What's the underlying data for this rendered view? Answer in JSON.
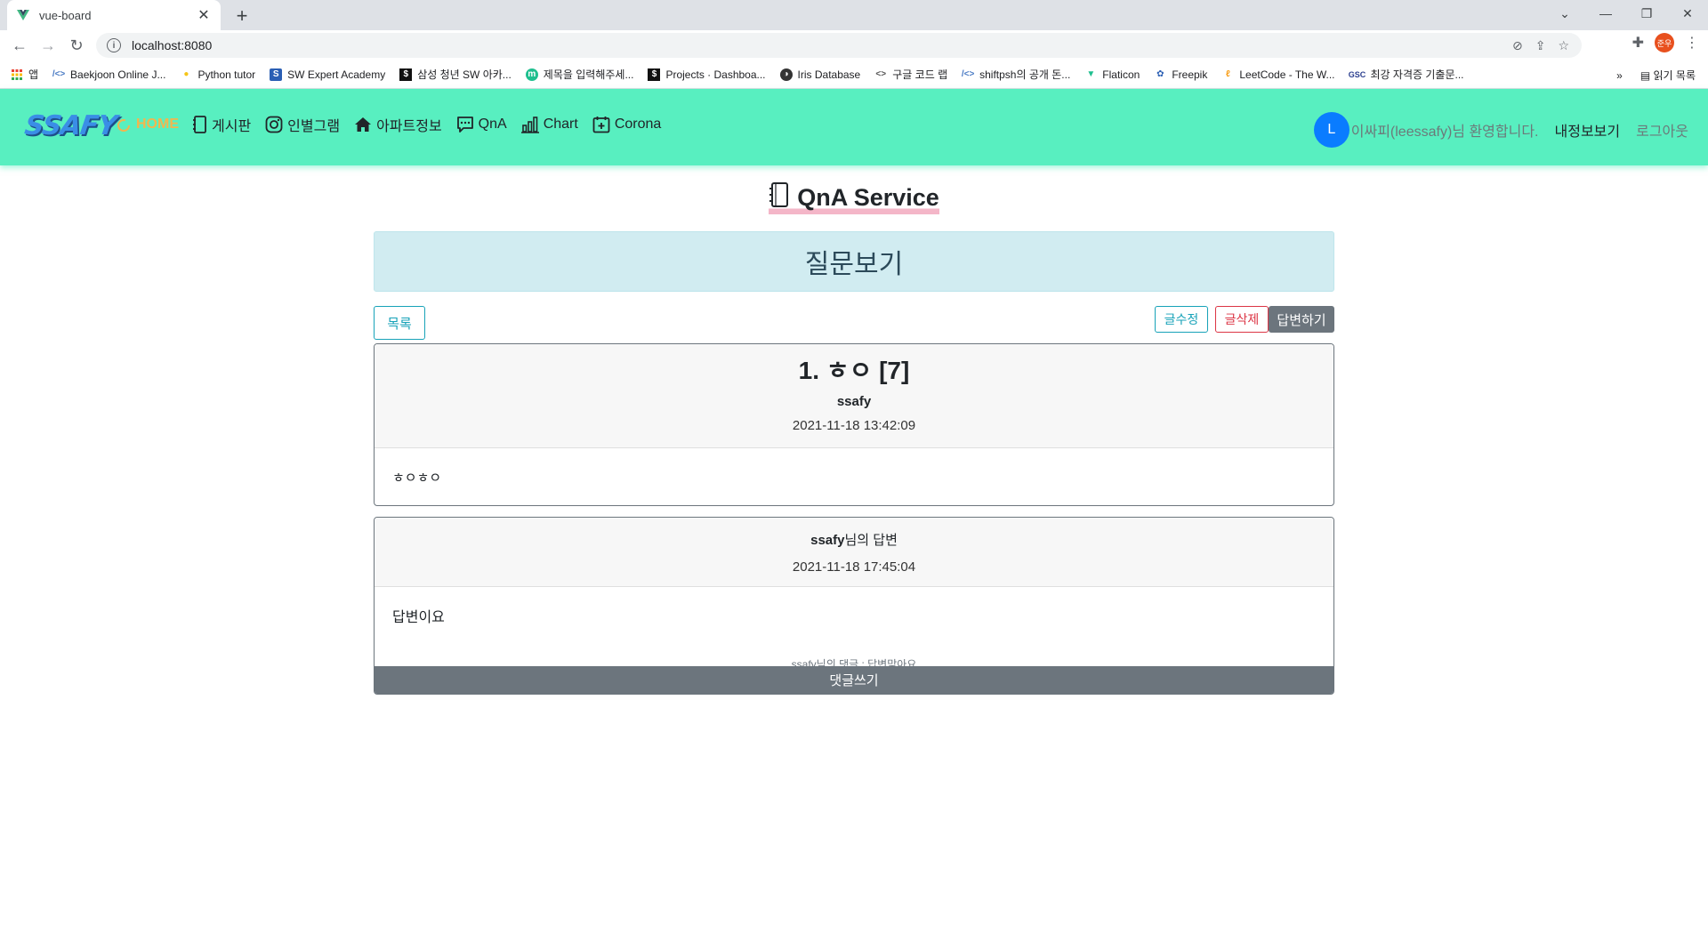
{
  "browser": {
    "tab_title": "vue-board",
    "url": "localhost:8080",
    "profile_initials": "준우",
    "bookmarks": [
      {
        "label": "앱",
        "icon": "apps-grid-icon"
      },
      {
        "label": "Baekjoon Online J...",
        "icon": "code-icon"
      },
      {
        "label": "Python tutor",
        "icon": "python-icon"
      },
      {
        "label": "SW Expert Academy",
        "icon": "swea-icon"
      },
      {
        "label": "삼성 청년 SW 아카...",
        "icon": "ssafy-icon"
      },
      {
        "label": "제목을 입력해주세...",
        "icon": "m-icon"
      },
      {
        "label": "Projects · Dashboa...",
        "icon": "gitlab-icon"
      },
      {
        "label": "Iris Database",
        "icon": "github-icon"
      },
      {
        "label": "구글 코드 랩",
        "icon": "code-brackets-icon"
      },
      {
        "label": "shiftpsh의 공개 돈...",
        "icon": "code-icon"
      },
      {
        "label": "Flaticon",
        "icon": "flaticon-icon"
      },
      {
        "label": "Freepik",
        "icon": "freepik-icon"
      },
      {
        "label": "LeetCode - The W...",
        "icon": "leetcode-icon"
      },
      {
        "label": "최강 자격증 기출문...",
        "icon": "gsc-icon"
      }
    ],
    "reading_list": "읽기 목록"
  },
  "navbar": {
    "logo": "SSAFY",
    "menu": [
      {
        "label": "HOME",
        "icon": "home-icon",
        "active": true
      },
      {
        "label": "게시판",
        "icon": "journal-icon"
      },
      {
        "label": "인별그램",
        "icon": "instagram-icon"
      },
      {
        "label": "아파트정보",
        "icon": "house-icon"
      },
      {
        "label": "QnA",
        "icon": "chat-dots-icon"
      },
      {
        "label": "Chart",
        "icon": "bar-chart-icon"
      },
      {
        "label": "Corona",
        "icon": "calendar-plus-icon"
      }
    ],
    "avatar_letter": "L",
    "welcome": "이싸피(leessafy)님 환영합니다.",
    "mypage": "내정보보기",
    "logout": "로그아웃"
  },
  "page": {
    "title": "QnA Service",
    "banner": "질문보기",
    "buttons": {
      "list": "목록",
      "edit": "글수정",
      "delete": "글삭제",
      "answer": "답변하기"
    }
  },
  "question": {
    "title": "1. ㅎㅇ [7]",
    "author": "ssafy",
    "date": "2021-11-18 13:42:09",
    "content": "ㅎㅇㅎㅇ"
  },
  "answer": {
    "author": "ssafy",
    "author_suffix": "님의 답변",
    "date": "2021-11-18 17:45:04",
    "content": "답변이요",
    "comment": "ssafy님의 댓글 : 답변맞아요",
    "comment_button": "댓글쓰기"
  },
  "colors": {
    "navbar_bg": "#58efc0",
    "active_menu": "#f2b64e",
    "banner_bg": "#d1ecf1",
    "info": "#17a2b8",
    "danger": "#dc3545",
    "secondary": "#6c757d"
  }
}
